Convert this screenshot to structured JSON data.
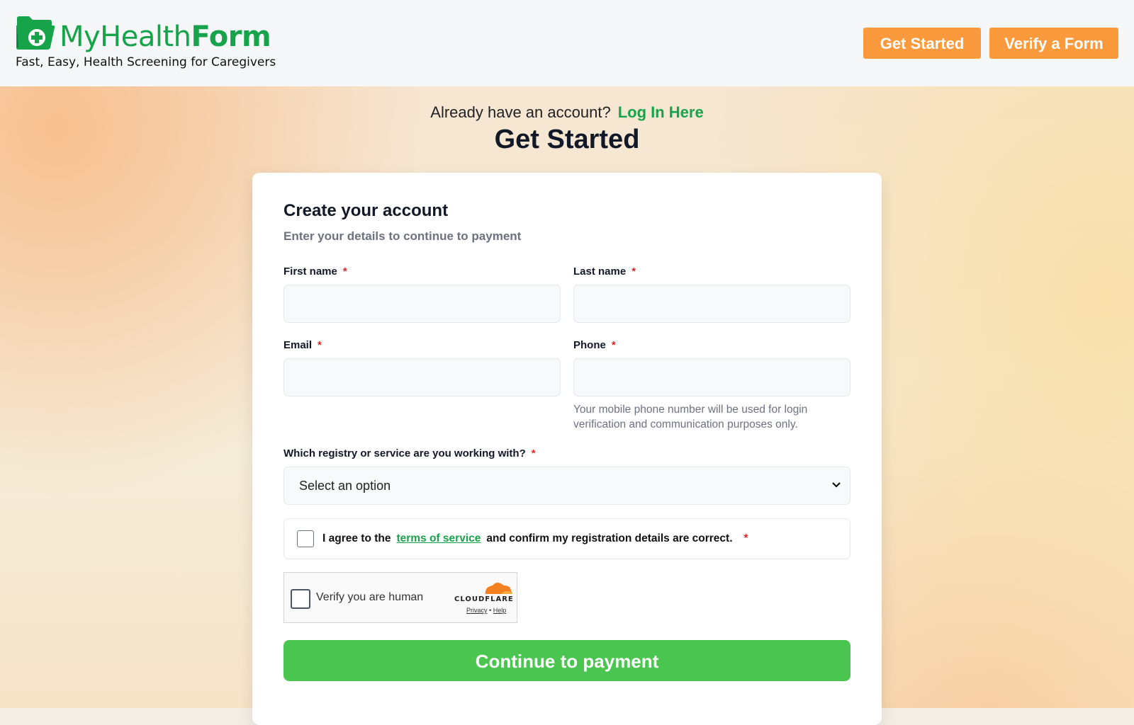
{
  "header": {
    "brand_regular": "MyHealth",
    "brand_bold": "Form",
    "tagline": "Fast, Easy, Health Screening for Caregivers",
    "get_started_label": "Get Started",
    "verify_label": "Verify a Form"
  },
  "intro": {
    "account_prompt": "Already have an account?",
    "login_link": "Log In Here",
    "title": "Get Started"
  },
  "form": {
    "title": "Create your account",
    "subtitle": "Enter your details to continue to payment",
    "required_mark": "*",
    "first_name": {
      "label": "First name",
      "value": ""
    },
    "last_name": {
      "label": "Last name",
      "value": ""
    },
    "email": {
      "label": "Email",
      "value": ""
    },
    "phone": {
      "label": "Phone",
      "value": "",
      "help": "Your mobile phone number will be used for login verification and communication purposes only."
    },
    "registry": {
      "label": "Which registry or service are you working with?",
      "selected": "Select an option"
    },
    "agree": {
      "prefix": "I agree to the",
      "link": "terms of service",
      "suffix": "and confirm my registration details are correct.",
      "checked": false
    },
    "captcha": {
      "label": "Verify you are human",
      "provider": "CLOUDFLARE",
      "privacy": "Privacy",
      "separator": "•",
      "help": "Help"
    },
    "submit_label": "Continue to payment"
  },
  "colors": {
    "brand_green": "#16a34a",
    "header_button": "#fb9a3c",
    "cta_green": "#4ac54f",
    "required_red": "#dc2626"
  }
}
